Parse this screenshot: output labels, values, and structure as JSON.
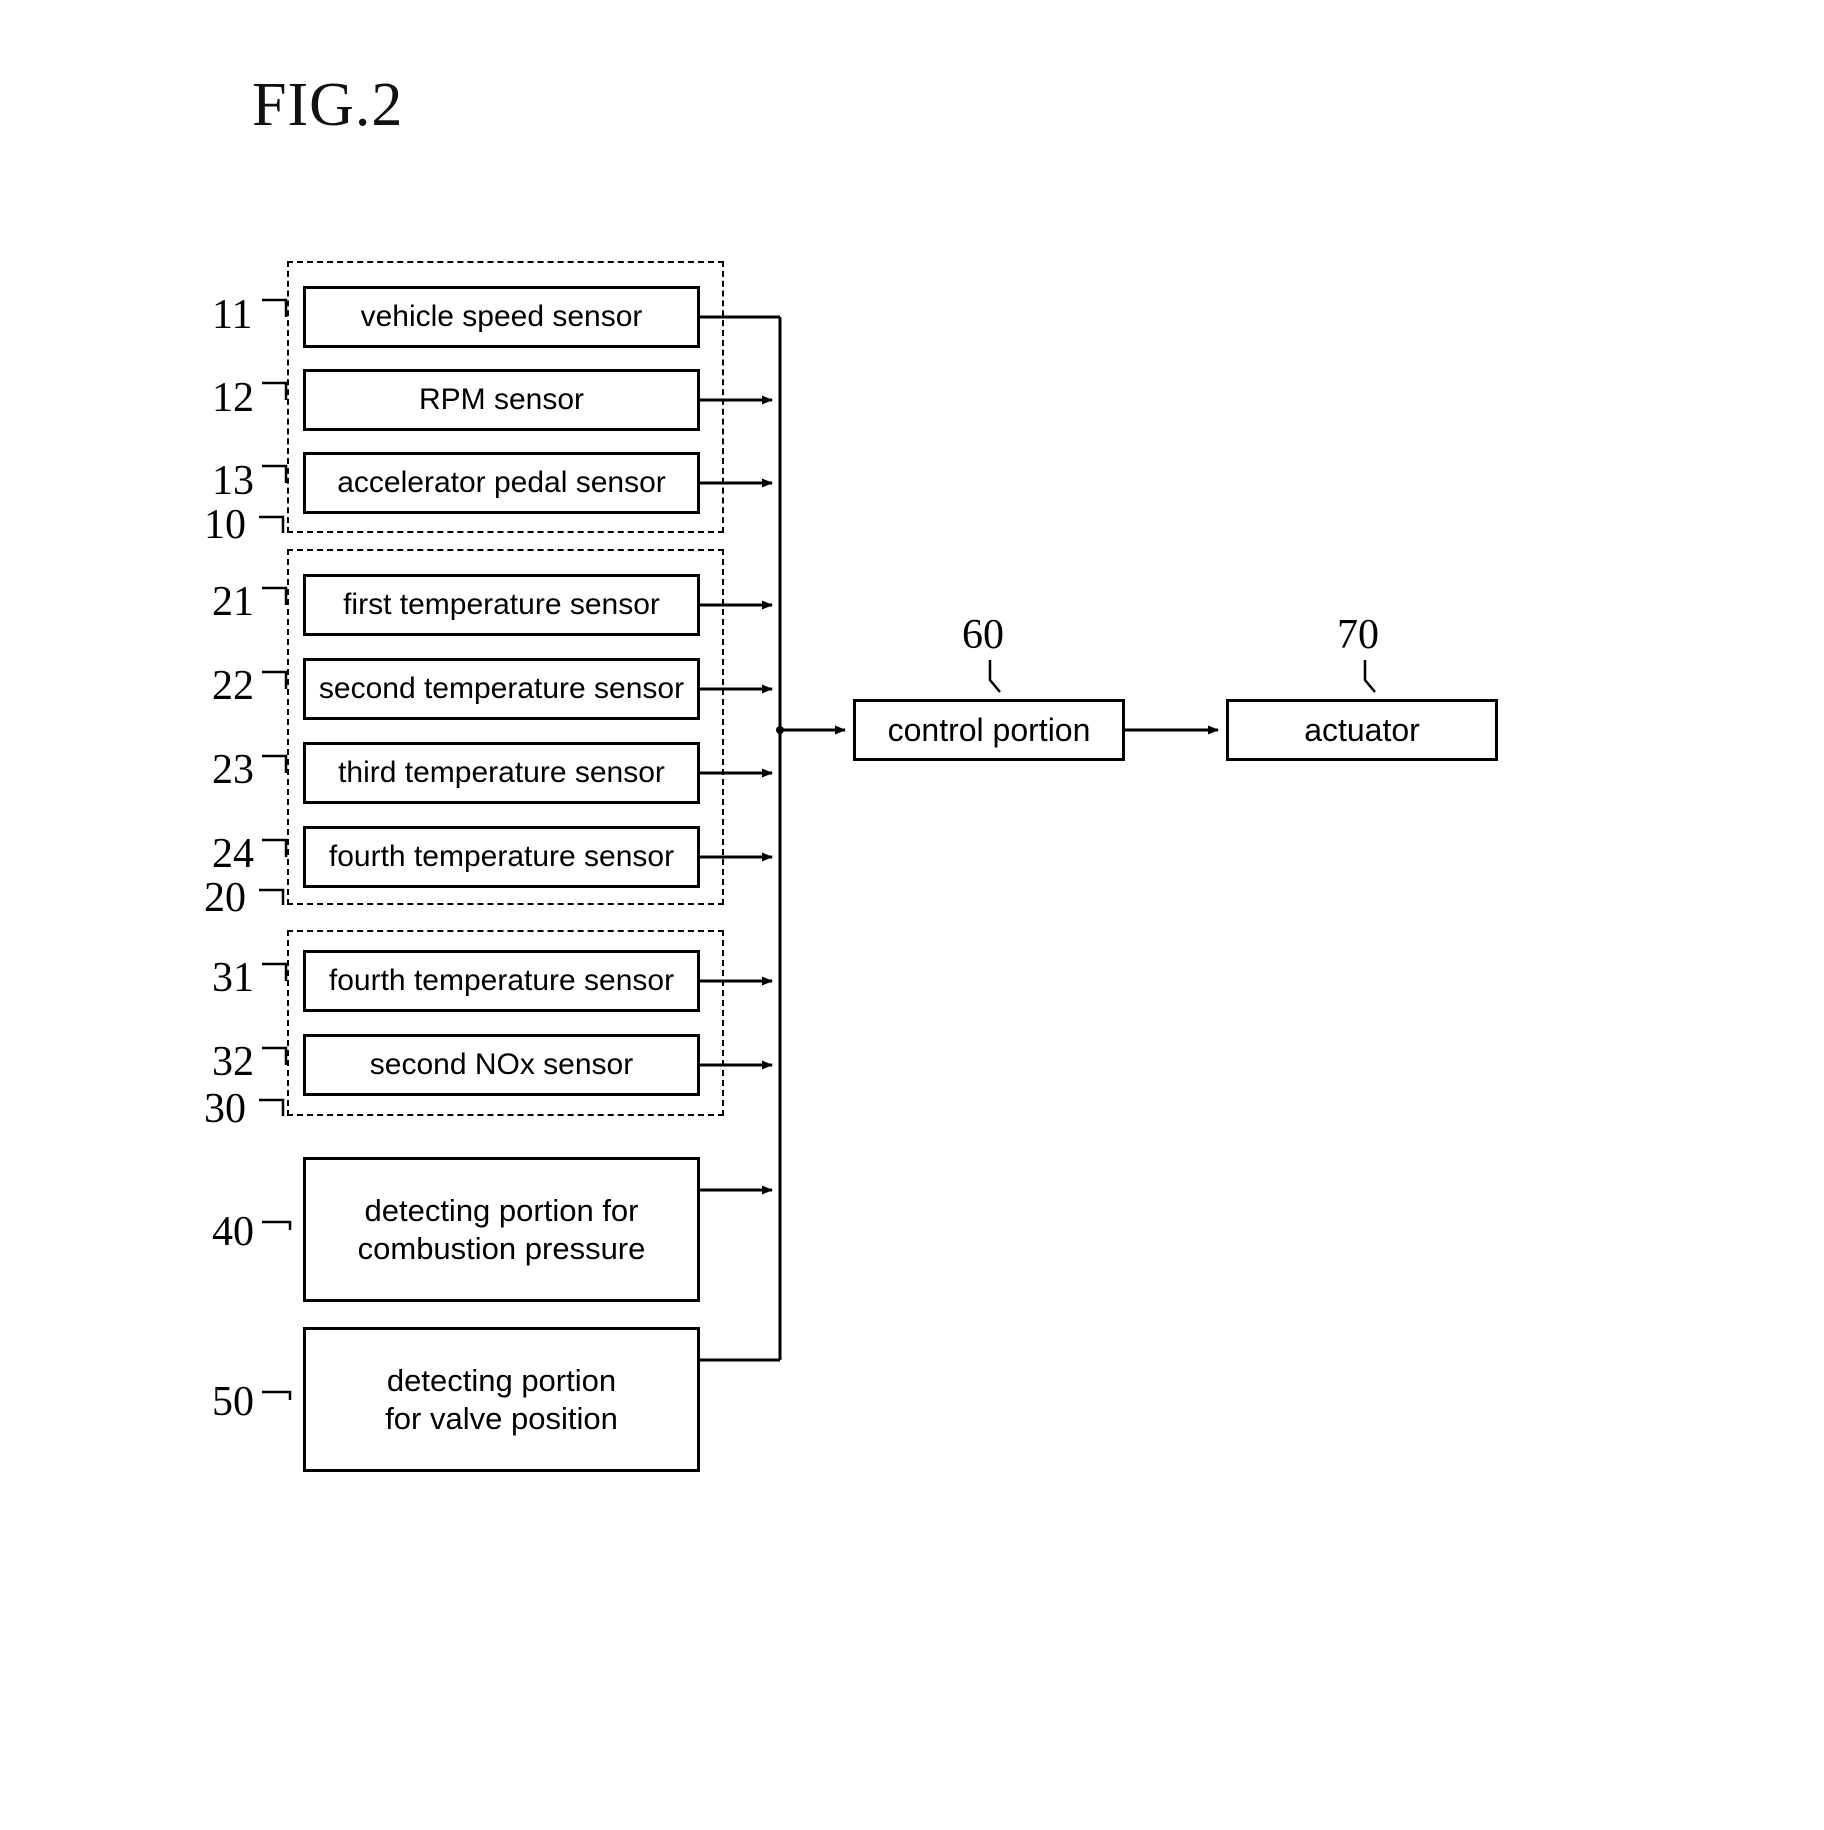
{
  "figure": {
    "title": "FIG.2",
    "type": "block-diagram"
  },
  "groups": [
    {
      "id": "10",
      "label": "10"
    },
    {
      "id": "20",
      "label": "20"
    },
    {
      "id": "30",
      "label": "30"
    }
  ],
  "blocks": [
    {
      "ref": "11",
      "label": "vehicle speed sensor"
    },
    {
      "ref": "12",
      "label": "RPM sensor"
    },
    {
      "ref": "13",
      "label": "accelerator pedal sensor"
    },
    {
      "ref": "21",
      "label": "first temperature sensor"
    },
    {
      "ref": "22",
      "label": "second temperature sensor"
    },
    {
      "ref": "23",
      "label": "third temperature sensor"
    },
    {
      "ref": "24",
      "label": "fourth temperature sensor"
    },
    {
      "ref": "31",
      "label": "fourth temperature sensor"
    },
    {
      "ref": "32",
      "label": "second NOx sensor"
    },
    {
      "ref": "40",
      "label": "detecting portion for combustion pressure",
      "line1": "detecting portion for",
      "line2": "combustion pressure"
    },
    {
      "ref": "50",
      "label": "detecting portion for valve position",
      "line1": "detecting portion",
      "line2": "for valve position"
    },
    {
      "ref": "60",
      "label": "control portion"
    },
    {
      "ref": "70",
      "label": "actuator"
    }
  ],
  "refs": {
    "r11": "11",
    "r12": "12",
    "r13": "13",
    "r10": "10",
    "r21": "21",
    "r22": "22",
    "r23": "23",
    "r24": "24",
    "r20": "20",
    "r31": "31",
    "r32": "32",
    "r30": "30",
    "r40": "40",
    "r50": "50",
    "r60": "60",
    "r70": "70"
  }
}
